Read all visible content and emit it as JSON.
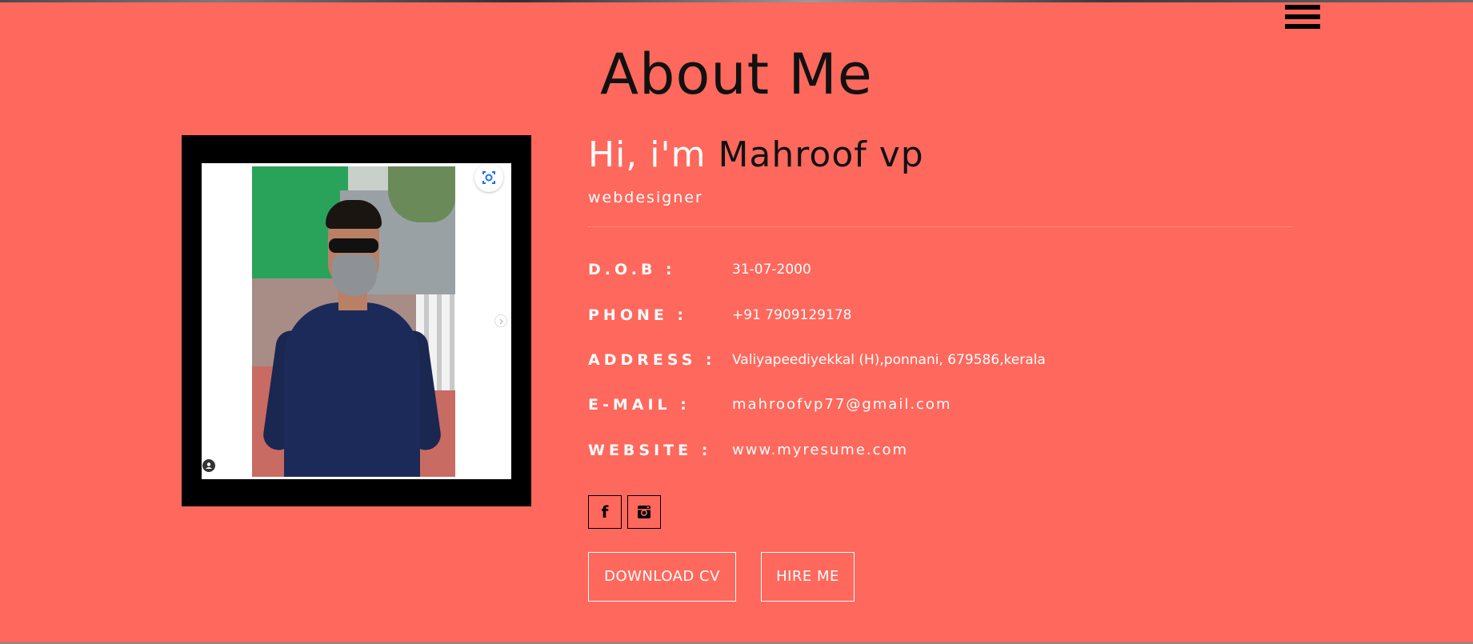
{
  "header": {
    "menu_icon": "hamburger-menu-icon"
  },
  "section": {
    "title": "About Me"
  },
  "photo": {
    "lens_icon": "lens-search-icon",
    "next_icon": "chevron-right-icon",
    "user_icon": "user-icon"
  },
  "profile": {
    "greeting": "Hi, i'm",
    "name": "Mahroof vp",
    "role": "webdesigner",
    "details": [
      {
        "label": "D.O.B :",
        "value": "31-07-2000"
      },
      {
        "label": "PHONE :",
        "value": "+91 7909129178"
      },
      {
        "label": "ADDRESS :",
        "value": "Valiyapeediyekkal (H),ponnani, 679586,kerala"
      },
      {
        "label": "E-MAIL :",
        "value": "mahroofvp77@gmail.com"
      },
      {
        "label": "WEBSITE :",
        "value": "www.myresume.com"
      }
    ]
  },
  "social": {
    "facebook_glyph": "f",
    "facebook_icon": "facebook-icon",
    "instagram_icon": "instagram-icon"
  },
  "actions": {
    "download_label": "DOWNLOAD CV",
    "hire_label": "HIRE ME"
  },
  "colors": {
    "background": "#ff685c",
    "photo_frame": "#000000",
    "text": "#ffffff",
    "title": "#111111"
  }
}
